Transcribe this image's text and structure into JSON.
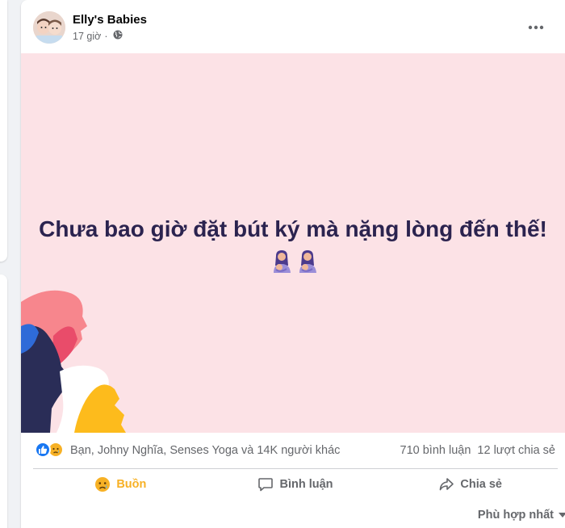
{
  "post": {
    "page_name": "Elly's Babies",
    "time": "17 giờ",
    "separator": "·",
    "privacy_icon": "globe-icon",
    "content_text": "Chưa bao giờ đặt bút ký mà nặng lòng đến thế!",
    "content_emoji": "breastfeeding-emoji",
    "background_color": "#fce2e6"
  },
  "reactions": {
    "icons": [
      "like-icon",
      "sad-face-icon"
    ],
    "names": "Bạn, Johny Nghĩa, Senses Yoga và 14K người khác",
    "comments": "710 bình luận",
    "shares": "12 lượt chia sẻ"
  },
  "actions": {
    "sad_label": "Buồn",
    "comment_label": "Bình luận",
    "share_label": "Chia sẻ"
  },
  "sort": {
    "label": "Phù hợp nhất"
  },
  "colors": {
    "accent_sad": "#f7b125",
    "like_blue": "#1877f2",
    "content_text": "#2b234f"
  }
}
